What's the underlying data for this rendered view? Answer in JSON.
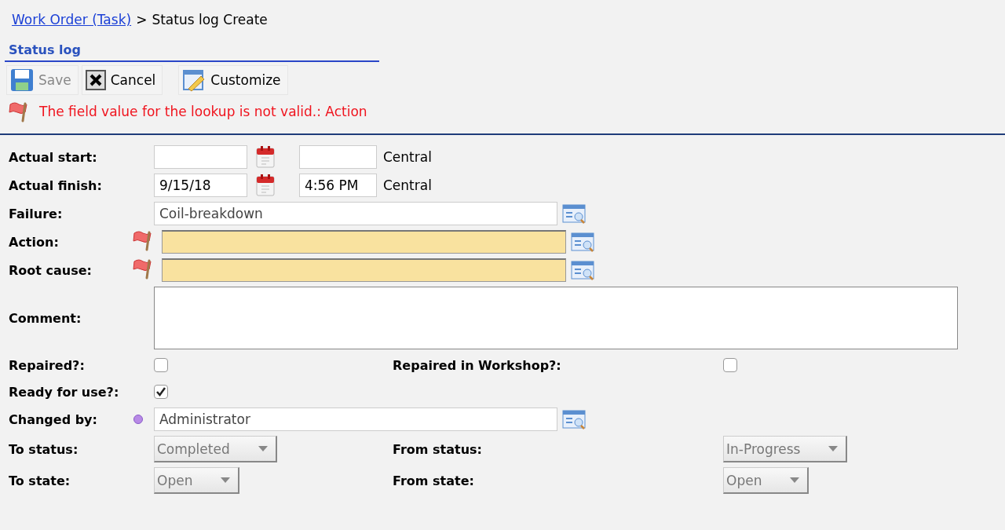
{
  "breadcrumb": {
    "link": "Work Order (Task)",
    "separator": ">",
    "current": "Status log Create"
  },
  "section_title": "Status log",
  "toolbar": [
    {
      "kind": "save",
      "label": "Save",
      "disabled": true
    },
    {
      "kind": "cancel",
      "label": "Cancel",
      "disabled": false
    },
    {
      "kind": "customize",
      "label": "Customize",
      "disabled": false
    }
  ],
  "error_message": "The field value for the lookup is not valid.: Action",
  "fields": [
    {
      "kind": "datetime",
      "label": "Actual start:",
      "timezone": "Central"
    },
    {
      "kind": "datetime",
      "label": "Actual finish:",
      "date": "9/15/18",
      "time": "4:56 PM",
      "timezone": "Central"
    },
    {
      "kind": "lookup",
      "label": "Failure:",
      "value": "Coil-breakdown",
      "invalid": false,
      "required": false
    },
    {
      "kind": "lookup",
      "label": "Action:",
      "invalid": true,
      "required": false
    },
    {
      "kind": "lookup",
      "label": "Root cause:",
      "invalid": true,
      "required": false
    },
    {
      "kind": "textarea",
      "label": "Comment:"
    },
    {
      "kind": "checkbox",
      "label": "Repaired?:",
      "checked": false,
      "right": {
        "label": "Repaired in Workshop?:",
        "checked": false
      }
    },
    {
      "kind": "checkbox",
      "label": "Ready for use?:",
      "checked": true
    },
    {
      "kind": "lookup",
      "label": "Changed by:",
      "value": "Administrator",
      "invalid": false,
      "required": true
    },
    {
      "kind": "select",
      "label": "To status:",
      "value": "Completed",
      "right": {
        "label": "From status:",
        "value": "In-Progress"
      }
    },
    {
      "kind": "select",
      "label": "To state:",
      "value": "Open",
      "right": {
        "label": "From state:",
        "value": "Open"
      }
    }
  ]
}
